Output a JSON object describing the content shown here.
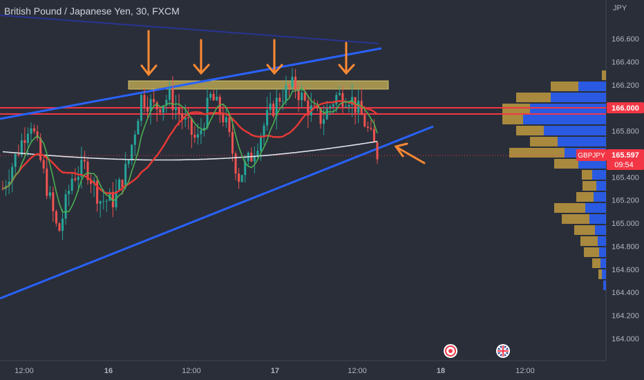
{
  "header": {
    "symbol_description": "British Pound / Japanese Yen",
    "interval": "30",
    "exchange": "FXCM"
  },
  "price_axis": {
    "unit": "JPY",
    "ticks": [
      "166.600",
      "166.400",
      "166.200",
      "166.000",
      "165.800",
      "165.400",
      "165.200",
      "165.000",
      "164.800",
      "164.600",
      "164.400",
      "164.200",
      "164.000"
    ],
    "current_price_label": {
      "symbol": "GBPJPY",
      "price": "165.597",
      "countdown": "09:54"
    },
    "level_label": "166.000"
  },
  "time_axis": {
    "ticks": [
      "12:00",
      "16",
      "12:00",
      "17",
      "12:00",
      "18",
      "12:00"
    ]
  },
  "colors": {
    "background": "#2a2e39",
    "bull": "#26a69a",
    "bear": "#ef5350",
    "trendline": "#2962ff",
    "upper_line": "#283593",
    "resistance_zone": "#c9b458",
    "horizontal_levels": "#f23645",
    "ema_green": "#4caf50",
    "ema_red": "#e53935",
    "sma_white": "#e0e3eb",
    "arrows": "#ff8a33",
    "volume_profile_up": "#2962ff",
    "volume_profile_down": "#c9a040"
  },
  "event_icons": [
    "event-marker-icon",
    "uk-flag-icon"
  ],
  "chart_data": {
    "type": "candlestick",
    "x_labels": [
      "12:00",
      "16",
      "12:00",
      "17",
      "12:00",
      "18",
      "12:00"
    ],
    "y_range": [
      163.85,
      166.85
    ],
    "series_approx_close": [
      165.3,
      165.6,
      165.9,
      165.4,
      164.9,
      165.4,
      165.5,
      165.2,
      165.2,
      165.5,
      166.1,
      166.0,
      166.1,
      165.9,
      165.7,
      166.1,
      165.9,
      165.4,
      165.6,
      165.9,
      166.1,
      166.2,
      166.0,
      165.9,
      166.1,
      166.1,
      165.9,
      165.6
    ],
    "annotations": {
      "resistance_zone": [
        166.2,
        166.3
      ],
      "horizontal_levels": [
        166.0,
        165.95
      ],
      "current_price": 165.597,
      "rising_support_line": {
        "from": 164.3,
        "to": 165.85
      },
      "rising_upper_line": {
        "from": 165.8,
        "to": 166.5
      }
    }
  }
}
